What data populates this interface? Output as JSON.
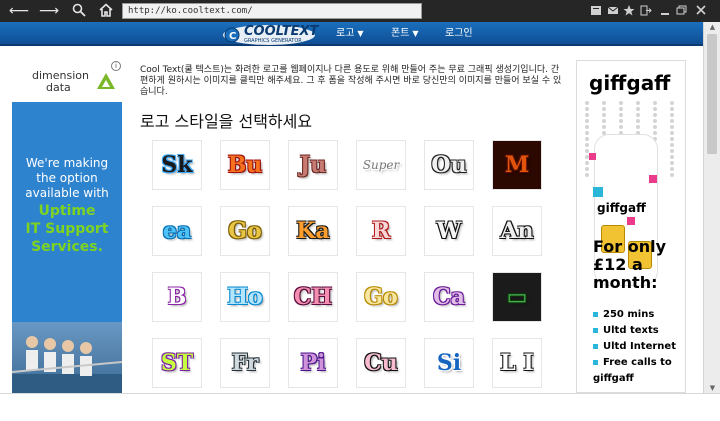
{
  "browser": {
    "url": "http://ko.cooltext.com/"
  },
  "site": {
    "logo_text": "COOLTEXT",
    "logo_sub": "GRAPHICS GENERATOR",
    "menu": [
      {
        "label": "로고",
        "has_caret": true
      },
      {
        "label": "폰트",
        "has_caret": true
      },
      {
        "label": "로그인",
        "has_caret": false
      }
    ]
  },
  "intro": {
    "text": "Cool Text(쿨 텍스트)는 화려한 로고를 웹페이지나 다른 용도로 위해 만들어 주는 무료 그래픽 생성기입니다. 간편하게 원하시는 이미지를 클릭만 해주세요. 그 후 폼을 작성해 주시면 바로 당신만의 이미지를 만들어 보실 수 있습니다."
  },
  "heading": "로고 스타일을 선택하세요",
  "left_ad": {
    "brand_line1": "dimension",
    "brand_line2": "data",
    "corner": "i",
    "lines_white": [
      "We're making",
      "the option",
      "available with"
    ],
    "lines_green": [
      "Uptime",
      "IT Support",
      "Services."
    ]
  },
  "right_ad": {
    "brand": "giffgaff",
    "sim_text": "giffgaff",
    "headline": "For only £12 a month:",
    "bullets": [
      "250 mins",
      "Ultd texts",
      "Ultd Internet",
      "Free calls to giffgaff"
    ]
  },
  "logo_styles": [
    {
      "text": "Sk",
      "color": "#1a1a1a",
      "outline": "#3fa9f5",
      "bg": "#ffffff"
    },
    {
      "text": "Bu",
      "color": "#f4721e",
      "outline": "#a01010",
      "bg": "#ffffff"
    },
    {
      "text": "Ju",
      "color": "#c77b72",
      "outline": "#6b2a25",
      "bg": "#ffffff"
    },
    {
      "text": "Super",
      "color": "#777777",
      "outline": "#ffffff",
      "bg": "#ffffff"
    },
    {
      "text": "Ou",
      "color": "#f0f0f0",
      "outline": "#222222",
      "bg": "#ffffff"
    },
    {
      "text": "M",
      "color": "#e2540e",
      "outline": "#5a1000",
      "bg": "#2b0800"
    },
    {
      "text": "ea",
      "color": "#4fc3f7",
      "outline": "#0a6fb3",
      "bg": "#ffffff"
    },
    {
      "text": "Go",
      "color": "#e8c547",
      "outline": "#7d5c00",
      "bg": "#ffffff"
    },
    {
      "text": "Ka",
      "color": "#ff9e2d",
      "outline": "#1a1a1a",
      "bg": "#ffffff"
    },
    {
      "text": "R",
      "color": "#f7d7d7",
      "outline": "#b01818",
      "bg": "#ffffff"
    },
    {
      "text": "W",
      "color": "#f5f5f5",
      "outline": "#111111",
      "bg": "#ffffff"
    },
    {
      "text": "An",
      "color": "#eeeeee",
      "outline": "#111111",
      "bg": "#ffffff"
    },
    {
      "text": "B",
      "color": "#ffffff",
      "outline": "#8e24aa",
      "bg": "#ffffff"
    },
    {
      "text": "Ho",
      "color": "#b3e5fc",
      "outline": "#0288d1",
      "bg": "#ffffff"
    },
    {
      "text": "CH",
      "color": "#f48fb1",
      "outline": "#5b0b3b",
      "bg": "#ffffff"
    },
    {
      "text": "Go",
      "color": "#f7e6a0",
      "outline": "#b88a00",
      "bg": "#ffffff"
    },
    {
      "text": "Ca",
      "color": "#e1bee7",
      "outline": "#6a1b9a",
      "bg": "#ffffff"
    },
    {
      "text": "▭",
      "color": "#4caf50",
      "outline": "#0b3b0b",
      "bg": "#1b1b1b"
    },
    {
      "text": "ST",
      "color": "#c6ff3d",
      "outline": "#7b1fa2",
      "bg": "#ffffff"
    },
    {
      "text": "Fr",
      "color": "#cfd8dc",
      "outline": "#263238",
      "bg": "#ffffff"
    },
    {
      "text": "Pi",
      "color": "#ce93d8",
      "outline": "#4a148c",
      "bg": "#ffffff"
    },
    {
      "text": "Cu",
      "color": "#f8bbd0",
      "outline": "#111111",
      "bg": "#ffffff"
    },
    {
      "text": "Si",
      "color": "#1565c0",
      "outline": "#ffffff",
      "bg": "#ffffff"
    },
    {
      "text": "L I",
      "color": "#ffffff",
      "outline": "#111111",
      "bg": "#ffffff"
    }
  ]
}
